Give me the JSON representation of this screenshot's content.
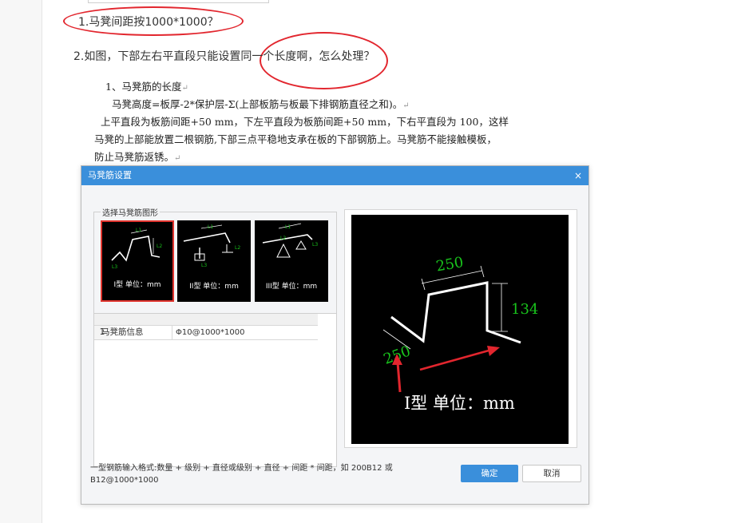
{
  "question1": "1.马凳间距按1000*1000？",
  "question2": "2.如图，下部左右平直段只能设置同一个长度啊，怎么处理？",
  "doc": {
    "line1": "1、马凳筋的长度",
    "line2": "马凳高度=板厚-2*保护层-Σ(上部板筋与板最下排钢筋直径之和)。",
    "line3": "上平直段为板筋间距+50 mm，下左平直段为板筋间距+50 mm，下右平直段为  100，这样",
    "line4": "马凳的上部能放置二根钢筋,下部三点平稳地支承在板的下部钢筋上。马凳筋不能接触模板，",
    "line5": "防止马凳筋返锈。",
    "return_mark": "↵"
  },
  "dialog": {
    "title": "马凳筋设置",
    "close": "×",
    "group_label": "选择马凳筋图形",
    "shapes": [
      {
        "caption": "I型 单位：mm",
        "selected": true,
        "l1": "L1",
        "l2": "L2",
        "l3": "L3"
      },
      {
        "caption": "II型 单位：mm",
        "selected": false,
        "l1": "L1",
        "l2": "L2",
        "l3": "L3"
      },
      {
        "caption": "III型 单位：mm",
        "selected": false,
        "l1": "L1",
        "l2": "L2",
        "l3": "L3"
      }
    ],
    "table": {
      "row_index": "1",
      "row_label": "马凳筋信息",
      "row_value": "Φ10@1000*1000"
    },
    "preview": {
      "dim_top": "250",
      "dim_right": "134",
      "dim_left": "250",
      "caption": "I型  单位：mm"
    },
    "hint": "一型钢筋输入格式:数量 + 级别 + 直径或级别 + 直径 + 间距 * 间距，如 200B12 或 B12@1000*1000",
    "ok": "确定",
    "cancel": "取消"
  },
  "colors": {
    "accent": "#3a8fdb",
    "annotation": "#e2262e",
    "dimension_green": "#19c31c"
  }
}
